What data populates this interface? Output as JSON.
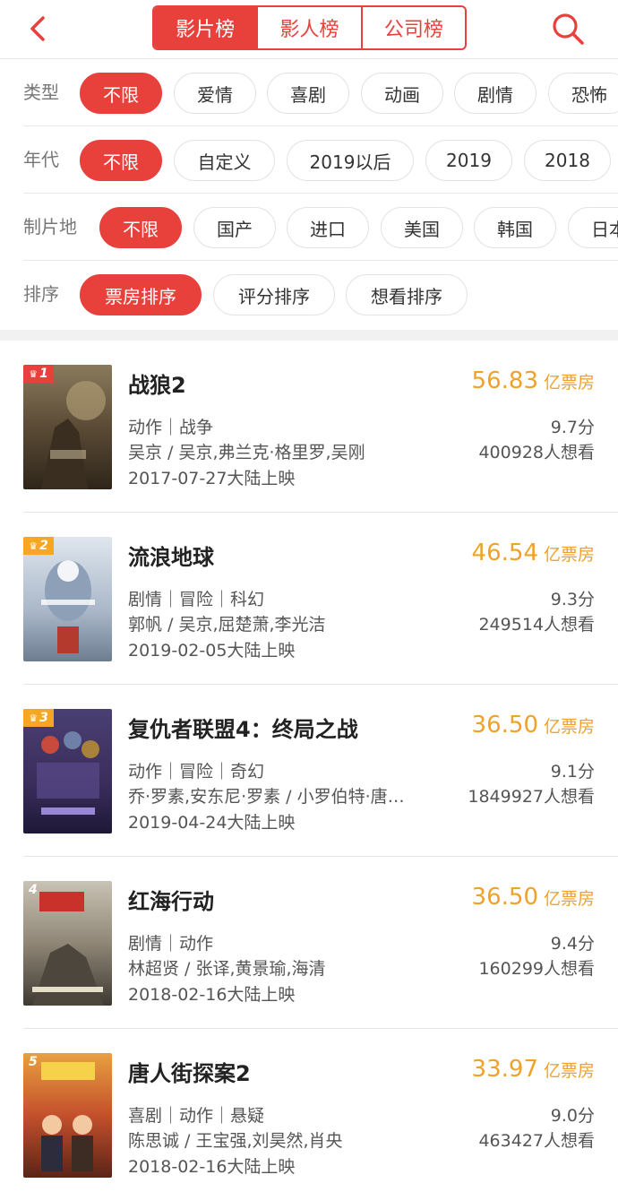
{
  "header": {
    "tabs": [
      {
        "label": "影片榜",
        "active": true
      },
      {
        "label": "影人榜",
        "active": false
      },
      {
        "label": "公司榜",
        "active": false
      }
    ]
  },
  "filters": [
    {
      "label": "类型",
      "options": [
        "不限",
        "爱情",
        "喜剧",
        "动画",
        "剧情",
        "恐怖"
      ],
      "selected": "不限"
    },
    {
      "label": "年代",
      "options": [
        "不限",
        "自定义",
        "2019以后",
        "2019",
        "2018"
      ],
      "selected": "不限"
    },
    {
      "label": "制片地",
      "options": [
        "不限",
        "国产",
        "进口",
        "美国",
        "韩国",
        "日本"
      ],
      "selected": "不限"
    },
    {
      "label": "排序",
      "options": [
        "票房排序",
        "评分排序",
        "想看排序"
      ],
      "selected": "票房排序"
    }
  ],
  "movies": [
    {
      "rank": "1",
      "title": "战狼2",
      "box_office": "56.83",
      "box_unit": "亿票房",
      "genres": "动作｜战争",
      "score": "9.7分",
      "cast": "吴京 / 吴京,弗兰克·格里罗,吴刚",
      "want": "400928人想看",
      "release": "2017-07-27大陆上映"
    },
    {
      "rank": "2",
      "title": "流浪地球",
      "box_office": "46.54",
      "box_unit": "亿票房",
      "genres": "剧情｜冒险｜科幻",
      "score": "9.3分",
      "cast": "郭帆 / 吴京,屈楚萧,李光洁",
      "want": "249514人想看",
      "release": "2019-02-05大陆上映"
    },
    {
      "rank": "3",
      "title": "复仇者联盟4：终局之战",
      "box_office": "36.50",
      "box_unit": "亿票房",
      "genres": "动作｜冒险｜奇幻",
      "score": "9.1分",
      "cast": "乔·罗素,安东尼·罗素 / 小罗伯特·唐…",
      "want": "1849927人想看",
      "release": "2019-04-24大陆上映"
    },
    {
      "rank": "4",
      "title": "红海行动",
      "box_office": "36.50",
      "box_unit": "亿票房",
      "genres": "剧情｜动作",
      "score": "9.4分",
      "cast": "林超贤 / 张译,黄景瑜,海清",
      "want": "160299人想看",
      "release": "2018-02-16大陆上映"
    },
    {
      "rank": "5",
      "title": "唐人街探案2",
      "box_office": "33.97",
      "box_unit": "亿票房",
      "genres": "喜剧｜动作｜悬疑",
      "score": "9.0分",
      "cast": "陈思诚 / 王宝强,刘昊然,肖央",
      "want": "463427人想看",
      "release": "2018-02-16大陆上映"
    }
  ],
  "colors": {
    "accent": "#e8413c",
    "box_office": "#f0a228",
    "rank_gold": "#f5a623"
  },
  "icons": {
    "back": "chevron-left-icon",
    "search": "search-icon",
    "rank_badge": "crown-icon"
  }
}
